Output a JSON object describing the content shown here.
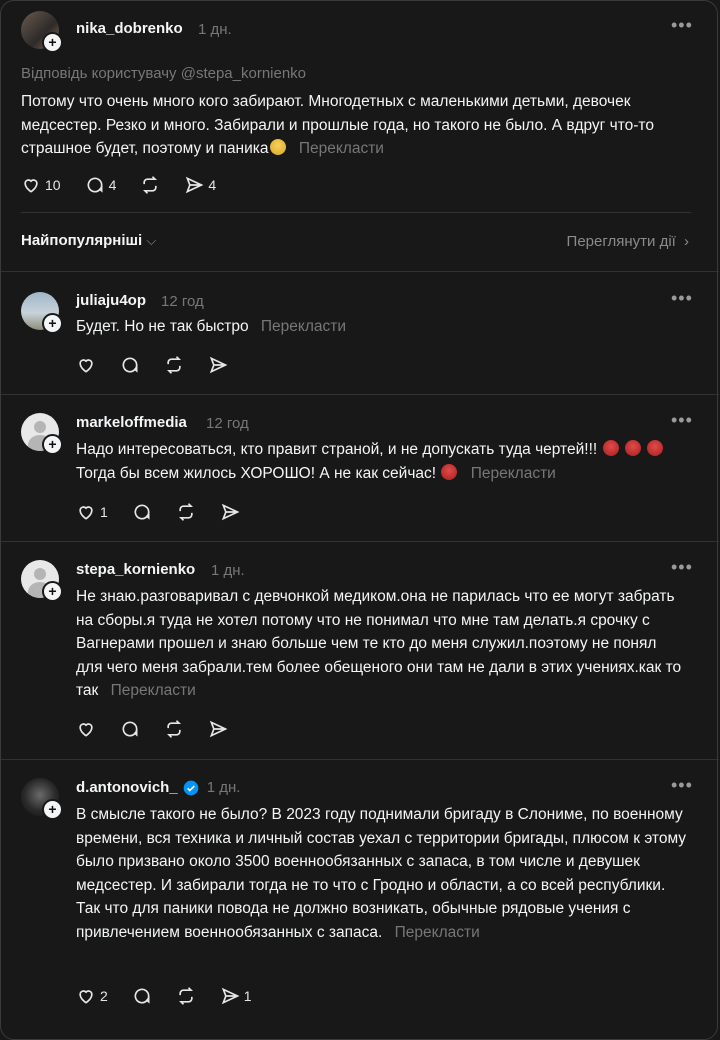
{
  "main_post": {
    "username": "nika_dobrenko",
    "time": "1 дн.",
    "reply_to": "Відповідь користувачу @stepa_kornienko",
    "text": "Потому что очень много кого забирают. Многодетных с маленькими детьми, девочек медсестер. Резко и много. Забирали и прошлые года, но такого не было. А вдруг что-то страшное будет, поэтому и паника",
    "translate": "Перекласти",
    "likes": "10",
    "comments": "4",
    "shares": "4"
  },
  "sort": {
    "label": "Найпопулярніші",
    "activity_label": "Переглянути дії"
  },
  "replies": [
    {
      "username": "juliaju4op",
      "time": "12 год",
      "text": "Будет. Но не так быстро",
      "translate": "Перекласти",
      "likes": "",
      "comments": "",
      "shares": ""
    },
    {
      "username": "markeloffmedia",
      "time": "12 год",
      "text_1": "Надо интересоваться, кто правит страной, и не допускать туда чертей!!!",
      "text_2": "Тогда бы всем жилось ХОРОШО! А не как сейчас!",
      "translate": "Перекласти",
      "likes": "1",
      "comments": "",
      "shares": ""
    },
    {
      "username": "stepa_kornienko",
      "time": "1 дн.",
      "text": "Не знаю.разговаривал с девчонкой медиком.она не парилась что ее могут забрать на сборы.я туда не хотел потому что не понимал что мне там делать.я срочку с Вагнерами прошел и знаю больше чем те кто до меня служил.поэтому не понял для чего меня забрали.тем более обещеного они там не дали в этих учениях.как то так",
      "translate": "Перекласти",
      "likes": "",
      "comments": "",
      "shares": ""
    },
    {
      "username": "d.antonovich_",
      "time": "1 дн.",
      "text": "В смысле такого не было? В 2023 году поднимали бригаду в Слониме, по военному времени, вся техника и личный состав уехал с территории бригады, плюсом к этому было призвано около 3500 военнообязанных с запаса, в том числе и девушек медсестер. И забирали тогда не то что с Гродно и области, а со всей республики. Так что для паники повода не должно возникать, обычные рядовые учения с привлечением военнообязанных с запаса.",
      "translate": "Перекласти",
      "likes": "2",
      "comments": "",
      "shares": "1"
    }
  ],
  "icons": {
    "more": "more-icon",
    "like": "heart-icon",
    "comment": "comment-icon",
    "repost": "repost-icon",
    "share": "send-icon",
    "verified": "verified-badge-icon",
    "chevron_down": "chevron-down-icon",
    "chevron_right": "chevron-right-icon"
  },
  "colors": {
    "background": "#181818",
    "text": "#f3f5f7",
    "muted": "#777777",
    "divider": "#323232",
    "verified": "#0095f6"
  }
}
